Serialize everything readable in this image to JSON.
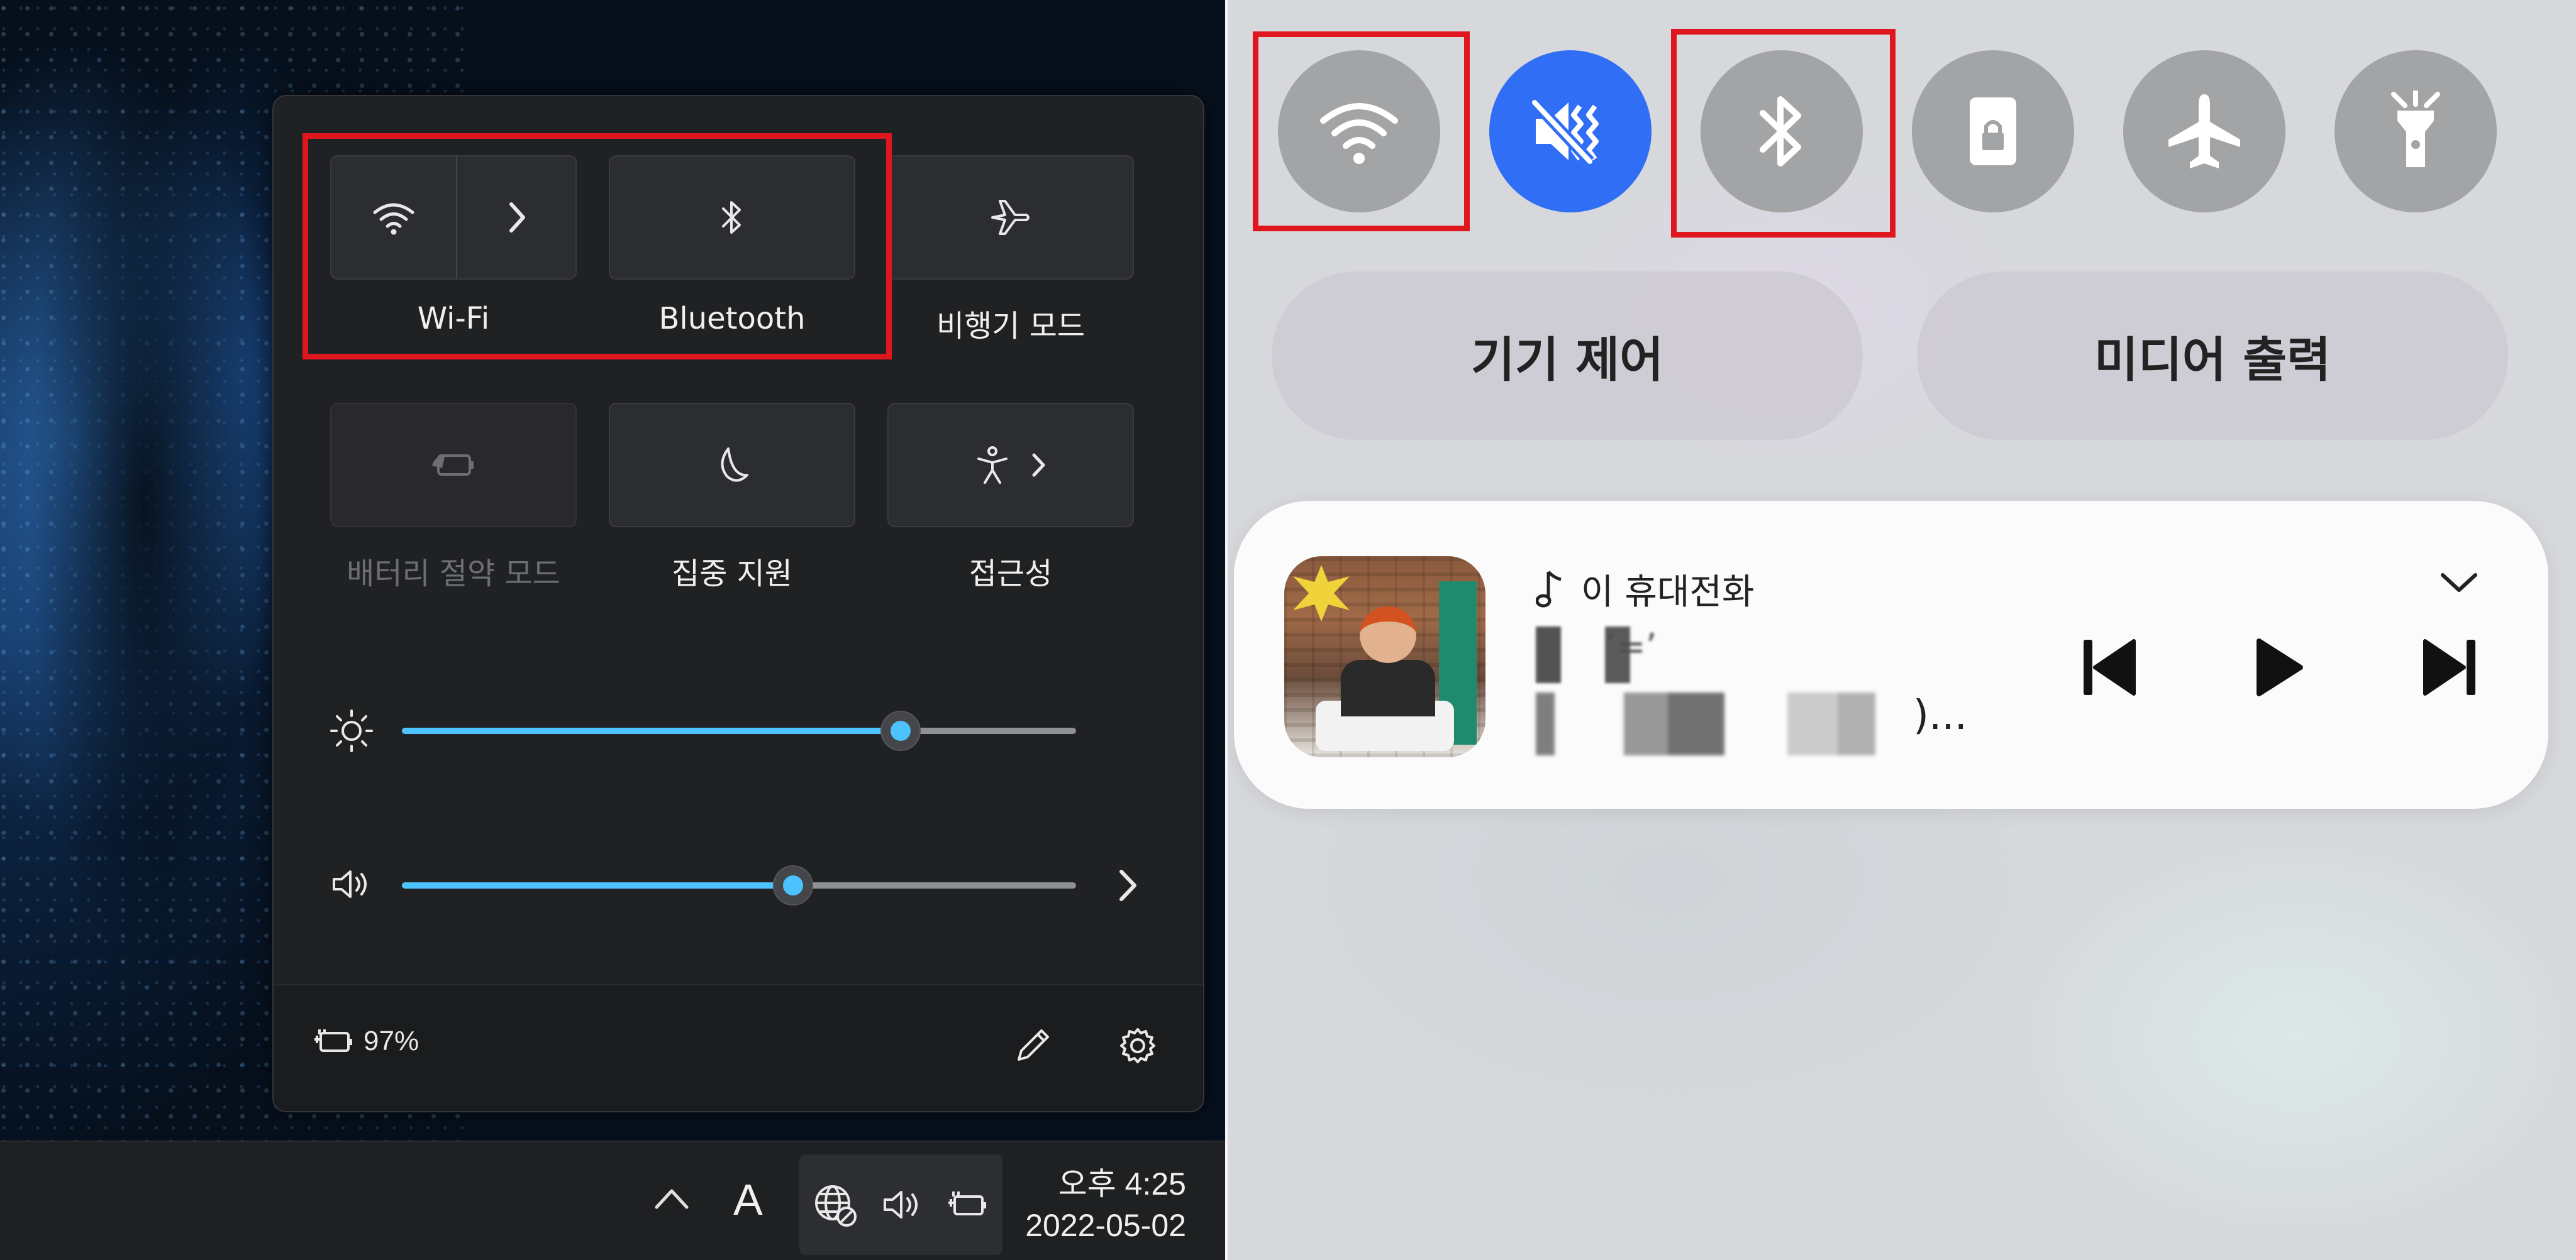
{
  "windows_panel": {
    "tiles": [
      {
        "label": "Wi-Fi",
        "icon": "wifi-icon",
        "has_arrow": true
      },
      {
        "label": "Bluetooth",
        "icon": "bluetooth-icon"
      },
      {
        "label": "비행기 모드",
        "icon": "airplane-icon"
      },
      {
        "label": "배터리 절약 모드",
        "icon": "battery-saver-icon",
        "disabled": true
      },
      {
        "label": "집중 지원",
        "icon": "moon-icon"
      },
      {
        "label": "접근성",
        "icon": "accessibility-icon",
        "has_arrow": true
      }
    ],
    "brightness_level": 0.74,
    "volume_level": 0.58,
    "battery_text": "97%",
    "accent_color": "#4cc2ff"
  },
  "taskbar": {
    "ime_label": "A",
    "time": "오후 4:25",
    "date": "2022-05-02"
  },
  "android_panel": {
    "quick_toggles": [
      {
        "name": "wifi",
        "icon": "wifi-icon",
        "active": false
      },
      {
        "name": "sound",
        "icon": "vibrate-mute-icon",
        "active": true
      },
      {
        "name": "bluetooth",
        "icon": "bluetooth-icon",
        "active": false
      },
      {
        "name": "screen-rotation-lock",
        "icon": "rotation-lock-icon",
        "active": false
      },
      {
        "name": "airplane",
        "icon": "airplane-icon",
        "active": false
      },
      {
        "name": "flashlight",
        "icon": "flashlight-icon",
        "active": false
      }
    ],
    "device_control_label": "기기 제어",
    "media_output_label": "미디어 출력",
    "media": {
      "source": "이 휴대전화",
      "title_visible": "’=’",
      "artist_visible": ")..."
    },
    "active_color": "#2f6ef5"
  }
}
